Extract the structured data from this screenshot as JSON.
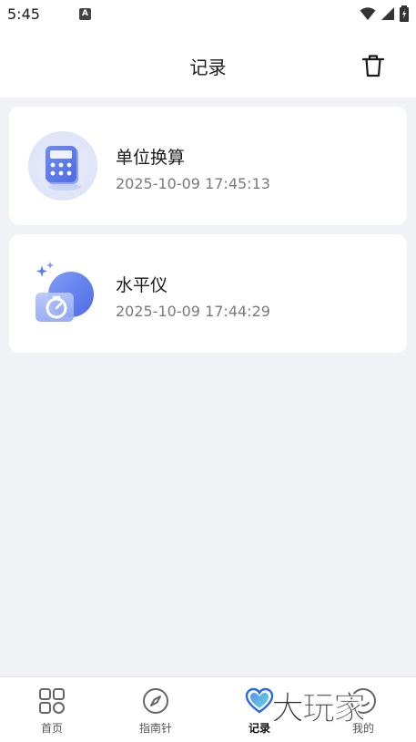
{
  "status_bar": {
    "time": "5:45",
    "notification_badge": "A"
  },
  "header": {
    "title": "记录"
  },
  "records": [
    {
      "title": "单位换算",
      "time": "2025-10-09 17:45:13",
      "icon": "calculator-icon"
    },
    {
      "title": "水平仪",
      "time": "2025-10-09 17:44:29",
      "icon": "level-meter-icon"
    }
  ],
  "nav": {
    "home": "首页",
    "compass": "指南针",
    "records": "记录",
    "mine": "我的"
  },
  "watermark": "大玩家",
  "colors": {
    "accent": "#5b7cf0",
    "background": "#f1f2f5",
    "card": "#ffffff"
  }
}
